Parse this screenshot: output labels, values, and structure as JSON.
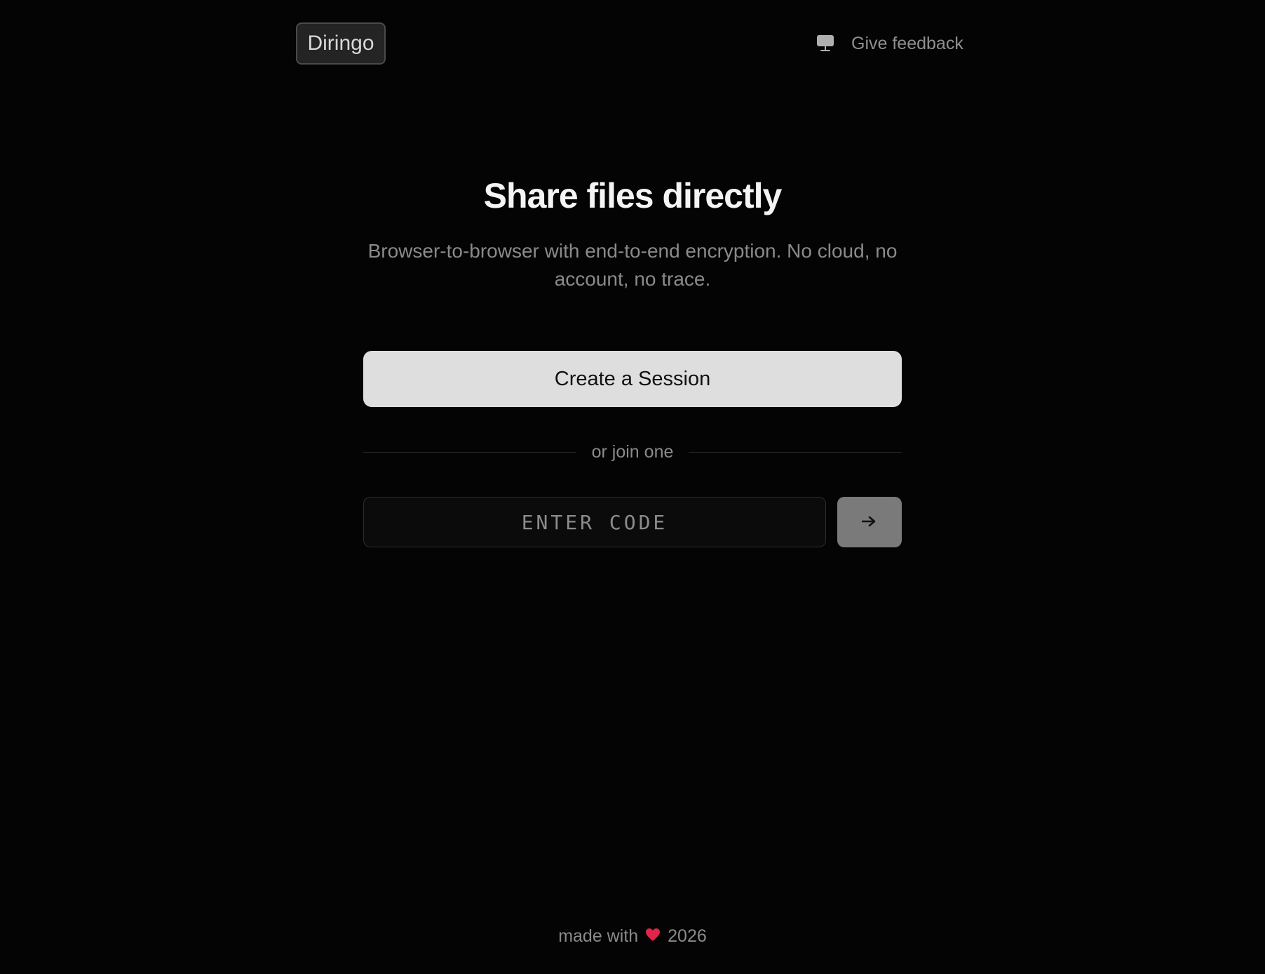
{
  "header": {
    "logo_label": "Diringo",
    "feedback_label": "Give feedback",
    "feedback_icon": "monitor-icon"
  },
  "hero": {
    "title": "Share files directly",
    "subtitle": "Browser-to-browser with end-to-end encryption. No cloud, no account, no trace."
  },
  "actions": {
    "create_label": "Create a Session",
    "divider_label": "or join one",
    "code_placeholder": "ENTER CODE",
    "code_value": "",
    "submit_icon": "arrow-right-icon"
  },
  "footer": {
    "made_with": "made with",
    "heart_icon": "heart-icon",
    "year": "2026"
  },
  "colors": {
    "background": "#040404",
    "primary_button": "#dedede",
    "submit_button": "#7a7a7a",
    "heart": "#e0244a"
  }
}
